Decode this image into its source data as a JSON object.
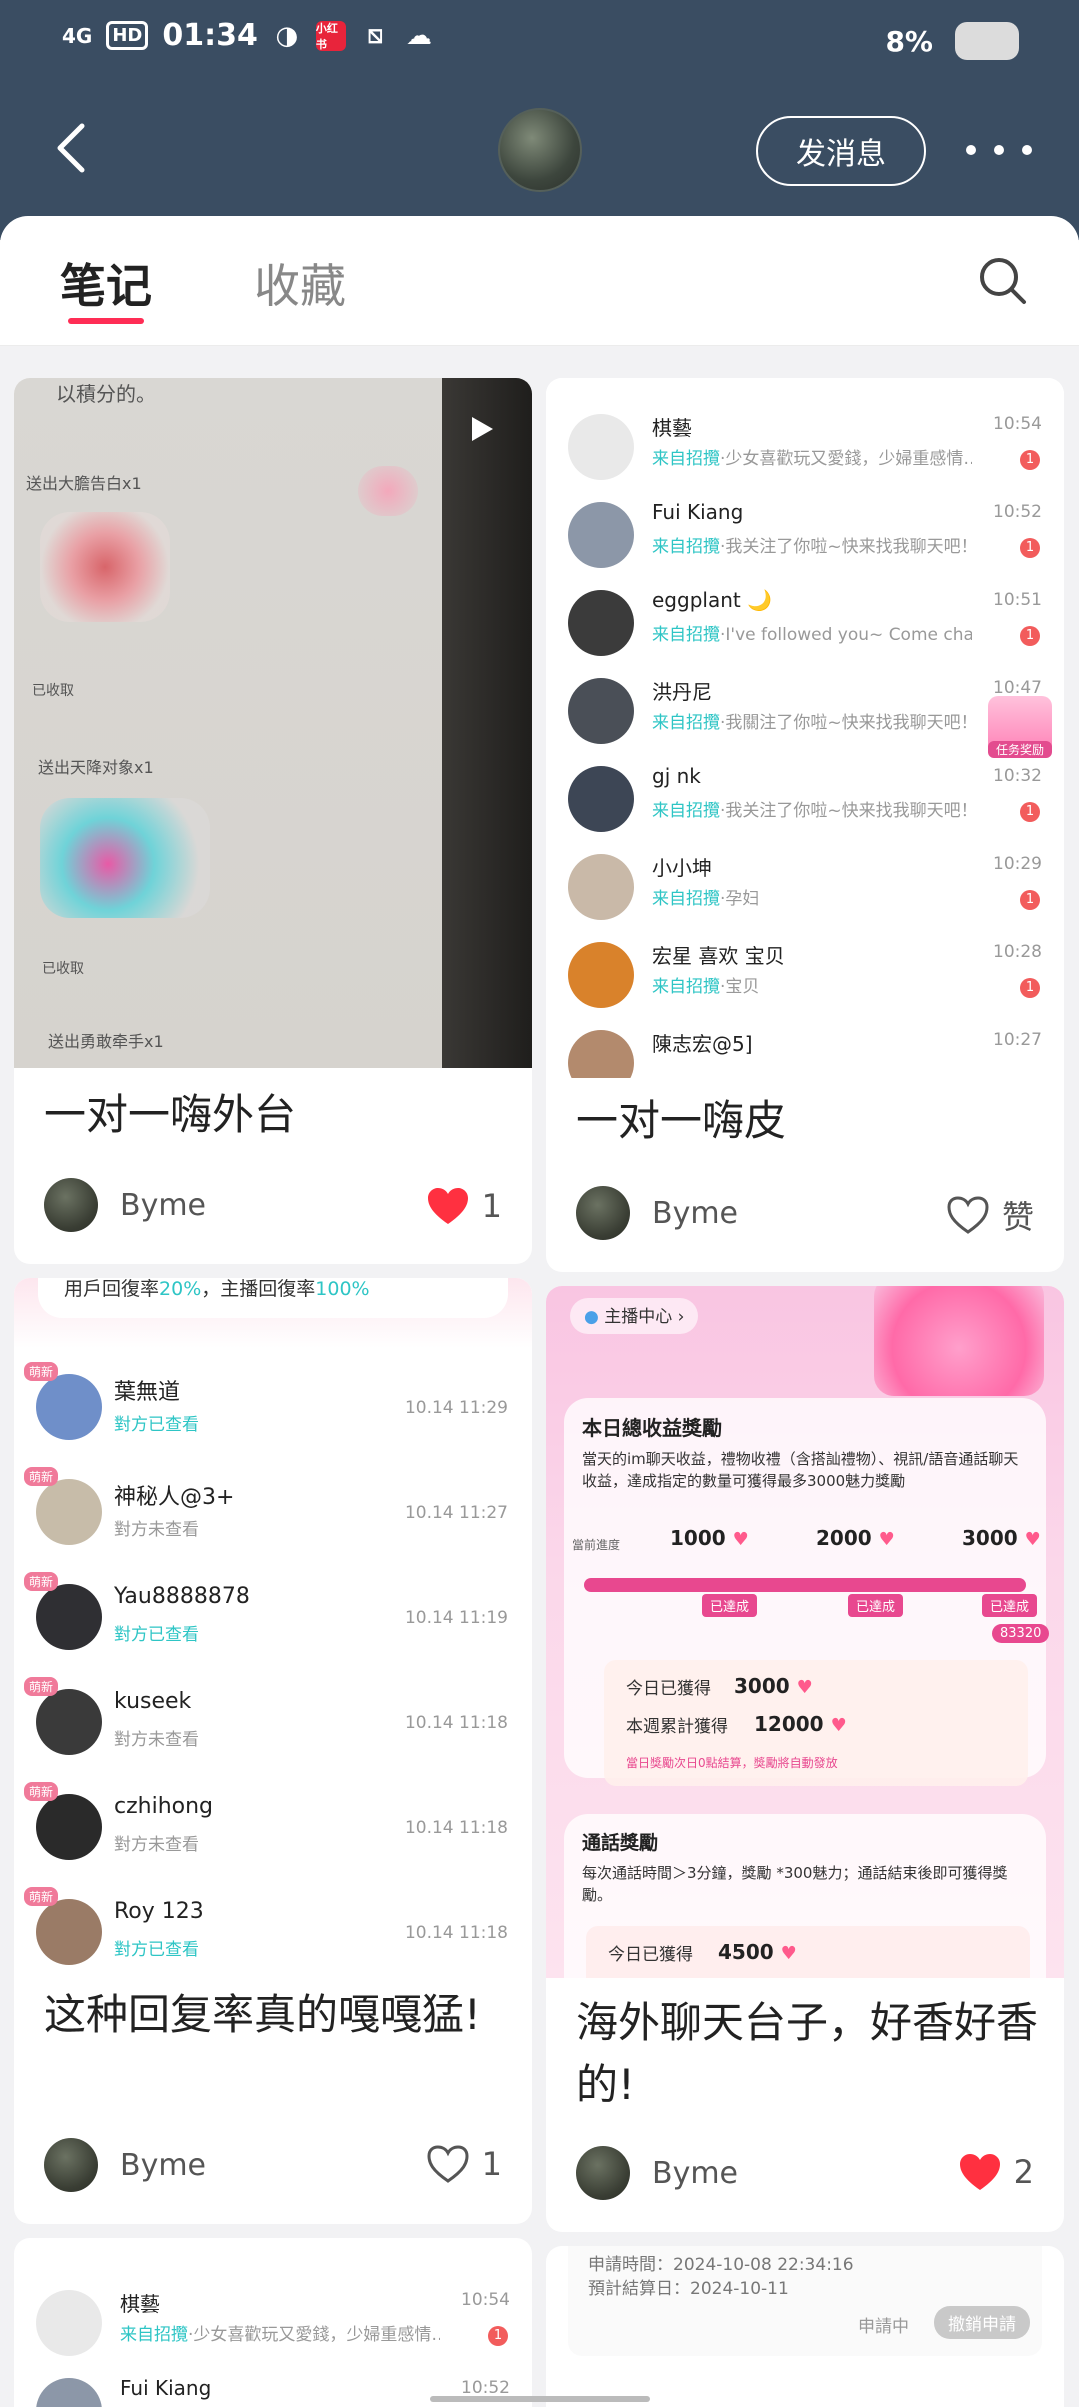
{
  "status_bar": {
    "network": "4G",
    "hd_badge": "HD",
    "time": "01:34",
    "app_badge": "小红书",
    "battery_level": "8"
  },
  "nav": {
    "send_message": "发消息"
  },
  "tabs": [
    {
      "label": "笔记",
      "selected": true
    },
    {
      "label": "收藏",
      "selected": false
    }
  ],
  "cards": [
    {
      "title": "一对一嗨外台",
      "author": "Byme",
      "like_state": "liked",
      "like_count": "1",
      "image": {
        "texts": [
          "以積分的。",
          "送出大膽告白x1",
          "已收取",
          "送出天降对象x1",
          "已收取",
          "送出勇敢牵手x1"
        ]
      }
    },
    {
      "title": "一对一嗨皮",
      "author": "Byme",
      "like_state": "not-liked",
      "like_count": "赞",
      "image": {
        "reward_tag": "任务奖励",
        "messages": [
          {
            "name": "棋藝",
            "source": "来自招攬",
            "preview": "·少女喜歡玩又愛錢，少婦重感情…",
            "time": "10:54",
            "unread": "1",
            "avatar_color": "#e9e9e9"
          },
          {
            "name": "Fui Kiang",
            "source": "来自招攬",
            "preview": "·我关注了你啦~快来找我聊天吧！",
            "time": "10:52",
            "unread": "1",
            "avatar_color": "#8c97a8"
          },
          {
            "name": "eggplant 🌙",
            "source": "来自招攬",
            "preview": "·I've followed you~ Come chat …",
            "time": "10:51",
            "unread": "1",
            "avatar_color": "#3b3b3b"
          },
          {
            "name": "洪丹尼",
            "source": "来自招攬",
            "preview": "·我關注了你啦~快来找我聊天吧！",
            "time": "10:47",
            "unread": "1",
            "avatar_color": "#4a4f57"
          },
          {
            "name": "gj nk",
            "source": "来自招攬",
            "preview": "·我关注了你啦~快来找我聊天吧！",
            "time": "10:32",
            "unread": "1",
            "avatar_color": "#3d4655"
          },
          {
            "name": "小小坤",
            "source": "来自招攬",
            "preview": "·孕妇",
            "time": "10:29",
            "unread": "1",
            "avatar_color": "#c9b9a8"
          },
          {
            "name": "宏星 喜欢 宝贝",
            "source": "来自招攬",
            "preview": "·宝贝",
            "time": "10:28",
            "unread": "1",
            "avatar_color": "#d9822b"
          },
          {
            "name": "陳志宏@5]",
            "source": "",
            "preview": "",
            "time": "10:27",
            "unread": "",
            "avatar_color": "#b38a6d"
          }
        ]
      }
    },
    {
      "title": "这种回复率真的嘎嘎猛!",
      "author": "Byme",
      "like_state": "not-liked",
      "like_count": "1",
      "image": {
        "banner_prefix": "用戶回復率",
        "banner_rate_user": "20%",
        "banner_mid": "，主播回復率",
        "banner_rate_host": "100%",
        "badge": "萌新",
        "rows": [
          {
            "name": "葉無道",
            "status": "對方已查看",
            "seen": true,
            "time": "10.14 11:29",
            "avatar_color": "#6f8fc9",
            "badge": true
          },
          {
            "name": "神秘人@3+",
            "status": "對方未查看",
            "seen": false,
            "time": "10.14 11:27",
            "avatar_color": "#c7bca9",
            "badge": true
          },
          {
            "name": "Yau8888878",
            "status": "對方已查看",
            "seen": true,
            "time": "10.14 11:19",
            "avatar_color": "#2f2f33",
            "badge": true
          },
          {
            "name": "kuseek",
            "status": "對方未查看",
            "seen": false,
            "time": "10.14 11:18",
            "avatar_color": "#3a3a3a",
            "badge": true
          },
          {
            "name": "czhihong",
            "status": "對方未查看",
            "seen": false,
            "time": "10.14 11:18",
            "avatar_color": "#2a2a2a",
            "badge": true
          },
          {
            "name": "Roy 123",
            "status": "對方已查看",
            "seen": true,
            "time": "10.14 11:18",
            "avatar_color": "#9a7b66",
            "badge": true
          }
        ]
      }
    },
    {
      "title": "海外聊天台子，好香好香的!",
      "author": "Byme",
      "like_state": "liked",
      "like_count": "2",
      "image": {
        "host_center": "主播中心",
        "daily_title": "本日總收益獎勵",
        "daily_desc": "當天的im聊天收益，禮物收禮（含搭訕禮物）、視訊/語音通話聊天收益，達成指定的數量可獲得最多3000魅力獎勵",
        "current_progress_label": "當前進度",
        "milestones": [
          "1000",
          "2000",
          "3000"
        ],
        "milestone_status": "已達成",
        "progress_value": "83320",
        "today_label": "今日已獲得",
        "today_value": "3000",
        "week_label": "本週累計獲得",
        "week_value": "12000",
        "notice": "當日獎勵次日0點結算，獎勵將自動發放",
        "call_title": "通話獎勵",
        "call_desc": "每次通話時間＞3分鐘，獎勵 *300魅力；通話結束後即可獲得獎勵。",
        "call_today_label": "今日已獲得",
        "call_today_value": "4500"
      }
    }
  ],
  "partial_bottom": {
    "left_rows": [
      {
        "name": "棋藝",
        "source": "来自招攬",
        "preview": "·少女喜歡玩又愛錢，少婦重感情…",
        "time": "10:54",
        "unread": "1"
      },
      {
        "name": "Fui Kiang",
        "source": "",
        "preview": "",
        "time": "10:52",
        "unread": ""
      }
    ],
    "right": {
      "apply_time": "申請時間：2024-10-08 22:34:16",
      "settle_date": "預計結算日：2024-10-11",
      "status": "申請中",
      "cancel": "撤銷申請"
    }
  },
  "colors": {
    "header_bg": "#3a4d62",
    "accent": "#ff2d55",
    "like_red": "#ff3040",
    "teal": "#2ec5c5"
  }
}
